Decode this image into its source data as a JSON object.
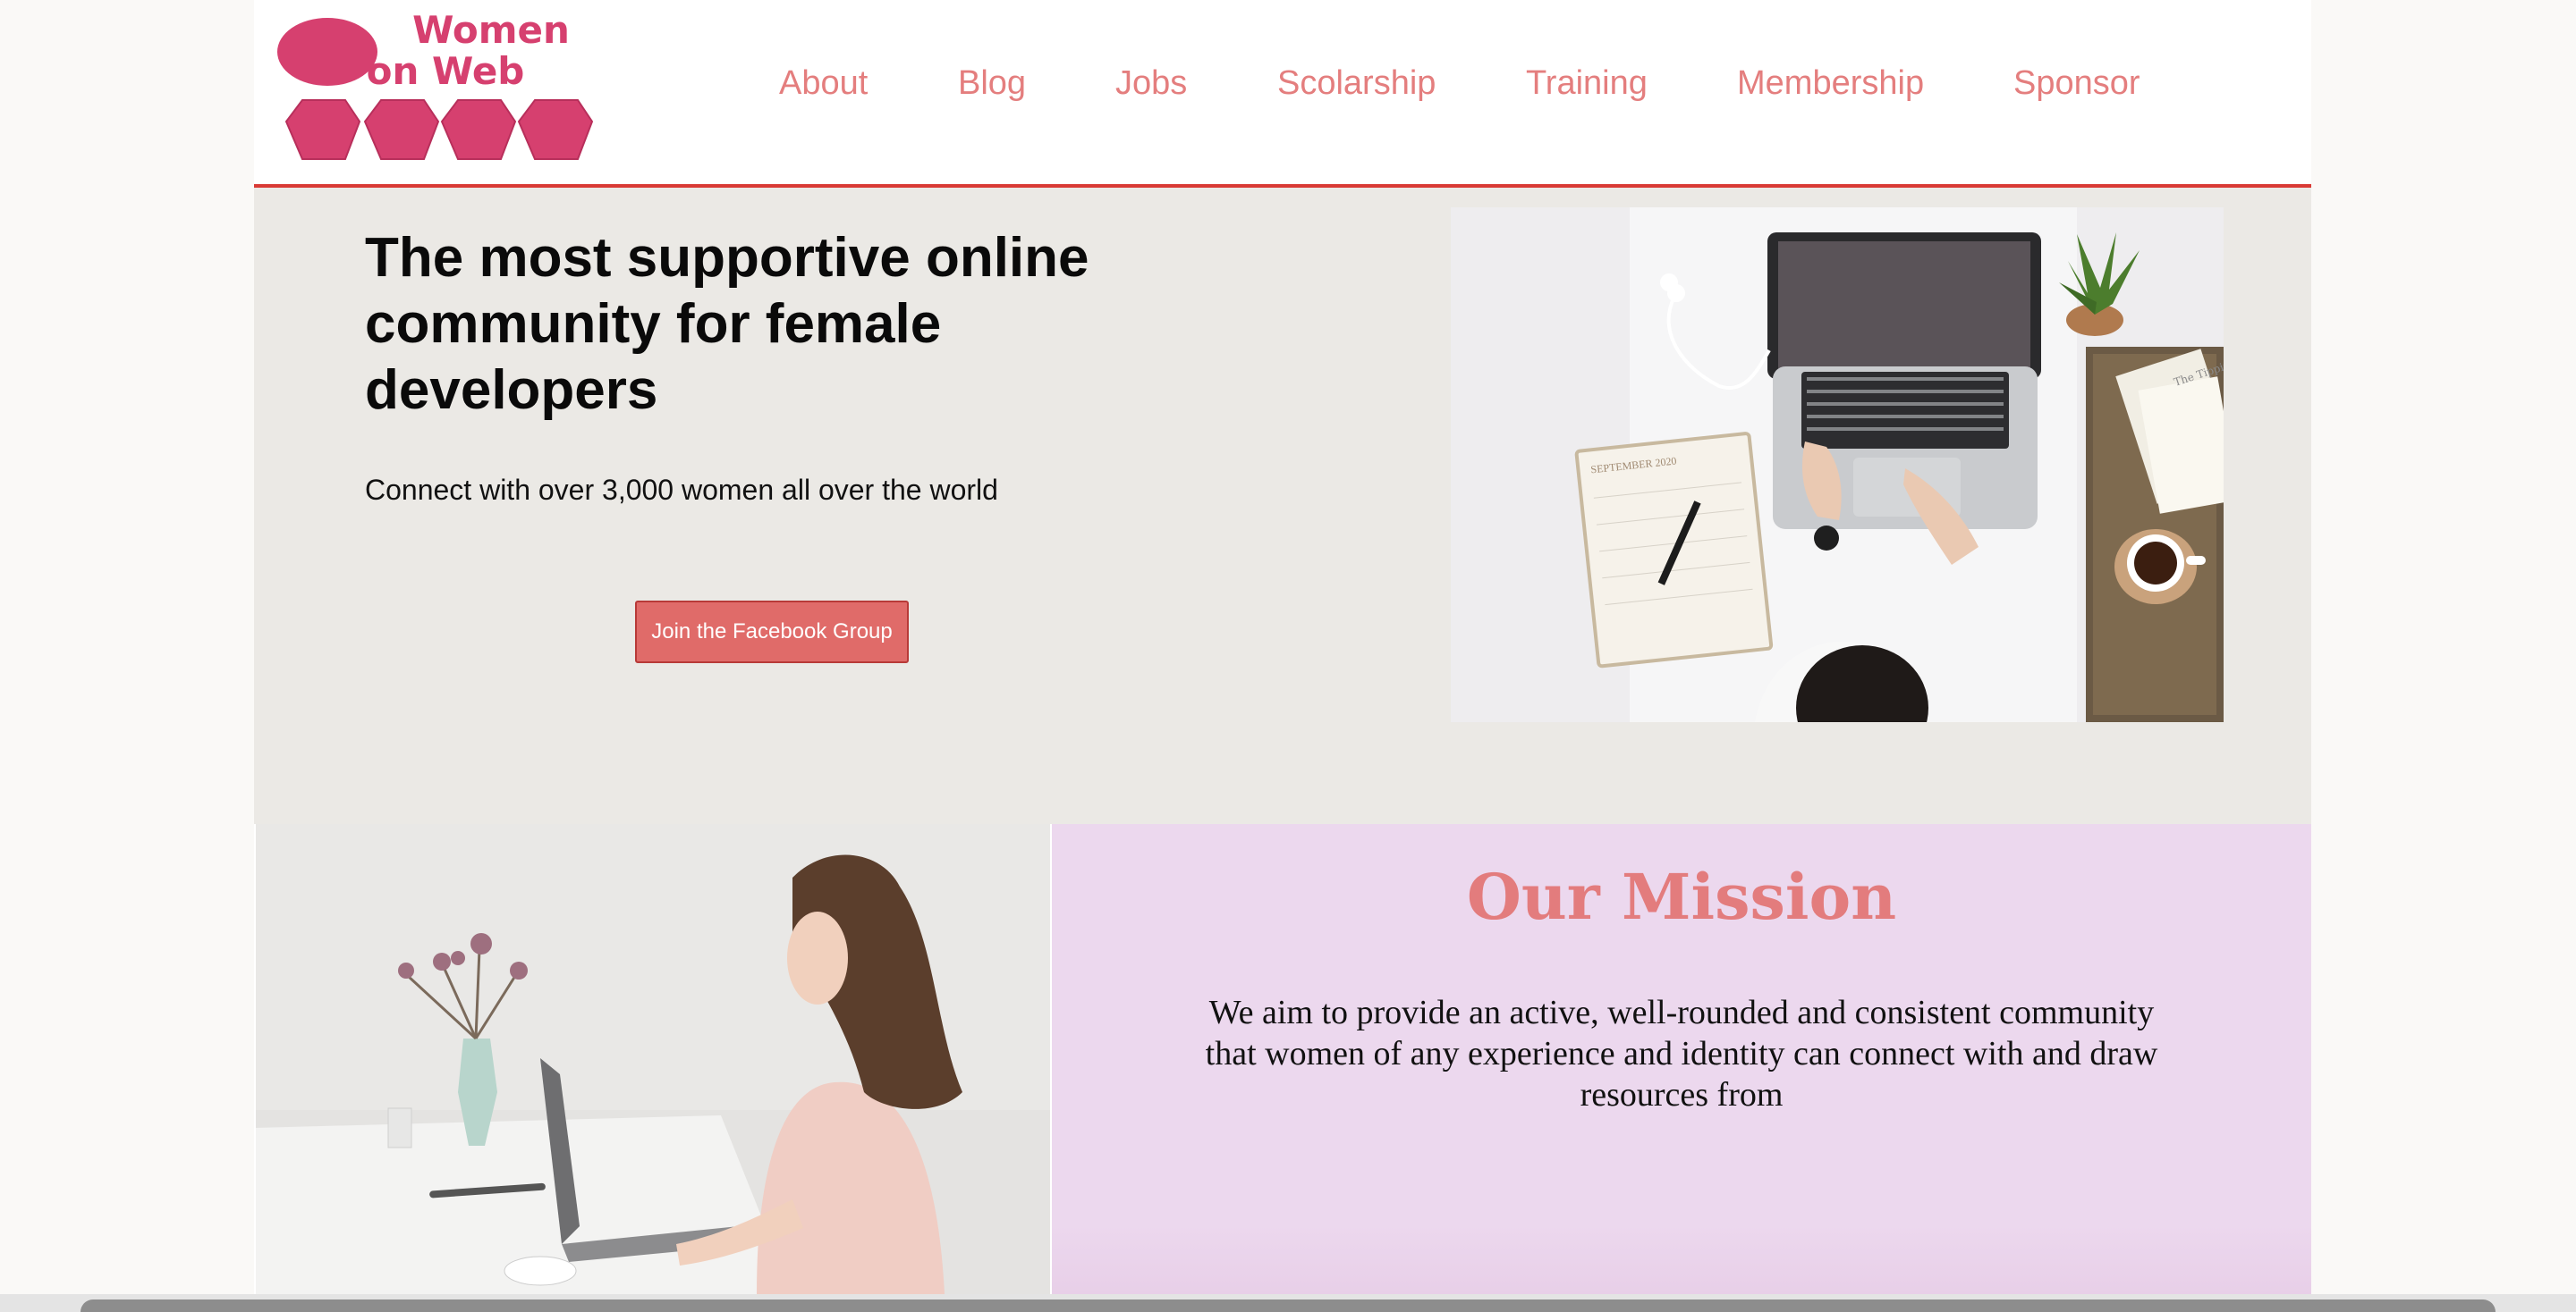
{
  "logo": {
    "line1": "Women",
    "line2": "on Web"
  },
  "nav": {
    "items": [
      {
        "label": "About"
      },
      {
        "label": "Blog"
      },
      {
        "label": "Jobs"
      },
      {
        "label": "Scolarship"
      },
      {
        "label": "Training"
      },
      {
        "label": "Membership"
      },
      {
        "label": "Sponsor"
      }
    ]
  },
  "hero": {
    "title": "The most supportive online community for female developers",
    "subtitle": "Connect with over 3,000 women all over the world",
    "button_label": "Join the Facebook Group",
    "photo_notebook_text": "SEPTEMBER 2020",
    "photo_book_text": "The Tipping Point"
  },
  "mission": {
    "title": "Our Mission",
    "text": "We aim to provide an active, well-rounded and consistent community that women of any experience and identity can connect with and draw resources from"
  },
  "colors": {
    "accent": "#e47e7e",
    "header_rule": "#d93a35",
    "button": "#e06b69",
    "hero_bg": "#ebe9e5",
    "mission_bg": "#ecd8ee"
  }
}
